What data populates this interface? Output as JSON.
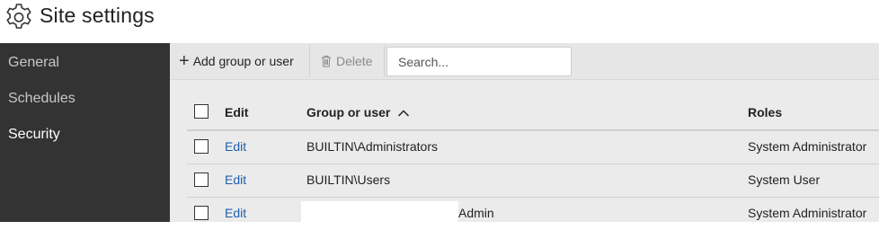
{
  "header": {
    "title": "Site settings",
    "icon": "gear-icon"
  },
  "sidebar": {
    "items": [
      {
        "label": "General",
        "active": false
      },
      {
        "label": "Schedules",
        "active": false
      },
      {
        "label": "Security",
        "active": true
      }
    ]
  },
  "toolbar": {
    "add_label": "Add group or user",
    "delete_label": "Delete",
    "search_placeholder": "Search..."
  },
  "table": {
    "columns": [
      "Edit",
      "Group or user",
      "Roles"
    ],
    "sort": {
      "column": "Group or user",
      "direction": "ascending"
    },
    "rows": [
      {
        "edit": "Edit",
        "name": "BUILTIN\\Administrators",
        "roles": "System Administrator"
      },
      {
        "edit": "Edit",
        "name": "BUILTIN\\Users",
        "roles": "System User"
      },
      {
        "edit": "Edit",
        "name": "Admin",
        "name_redacted_prefix": true,
        "roles": "System Administrator"
      }
    ]
  },
  "colors": {
    "sidebar_bg": "#333333",
    "content_bg": "#ebebeb",
    "link": "#1f5fad",
    "sidebar_active_text": "#ffffff",
    "sidebar_text": "#c8c8c8"
  }
}
